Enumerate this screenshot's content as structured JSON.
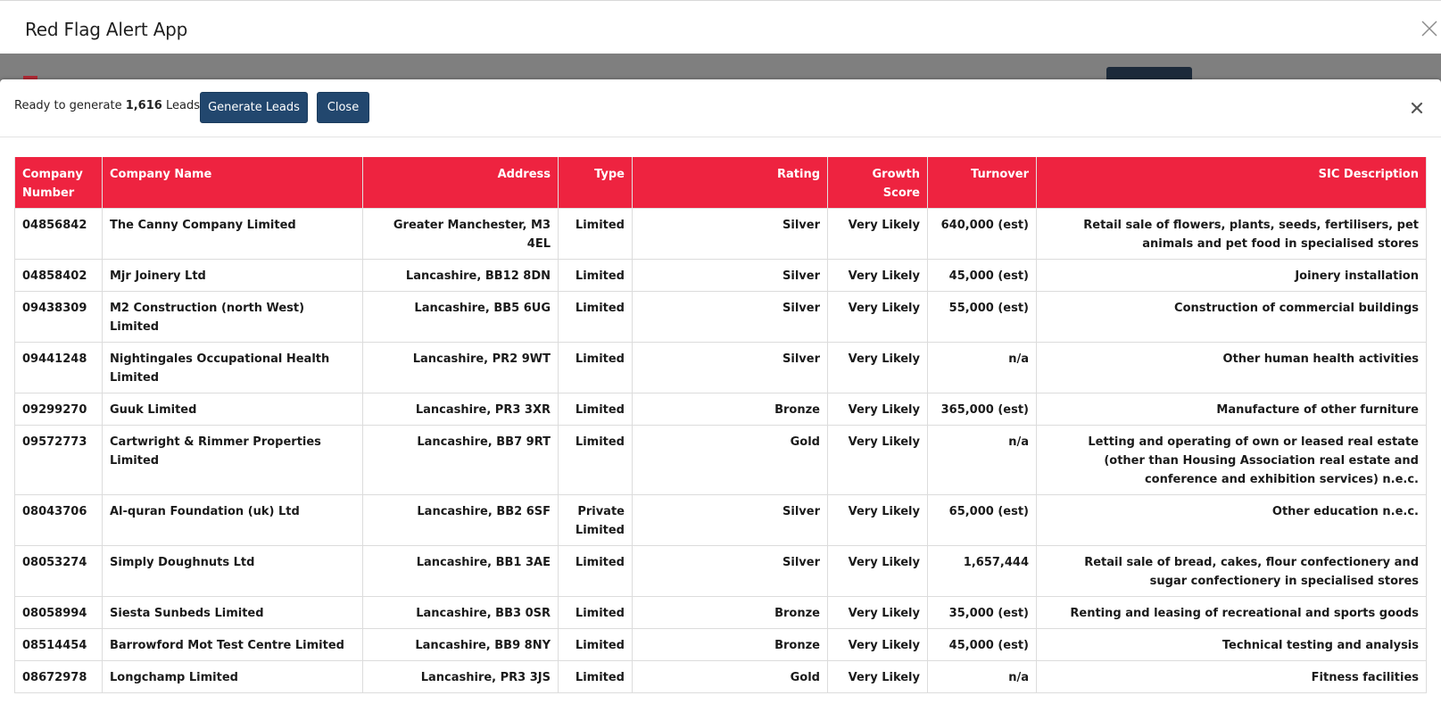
{
  "app": {
    "title": "Red Flag Alert App",
    "close_icon": "close-icon"
  },
  "dialog": {
    "ready_prefix": "Ready to generate ",
    "lead_count": "1,616",
    "ready_suffix": " Leads.",
    "generate_label": "Generate Leads",
    "close_label": "Close",
    "dismiss_icon": "close-x-icon"
  },
  "colors": {
    "header_red": "#ee2340",
    "button_navy": "#22476e",
    "backdrop_gray": "#7f7f7f"
  },
  "table": {
    "columns": [
      {
        "key": "number",
        "label": "Company Number"
      },
      {
        "key": "name",
        "label": "Company Name"
      },
      {
        "key": "address",
        "label": "Address"
      },
      {
        "key": "type",
        "label": "Type"
      },
      {
        "key": "rating",
        "label": "Rating"
      },
      {
        "key": "growth",
        "label": "Growth Score"
      },
      {
        "key": "turnover",
        "label": "Turnover"
      },
      {
        "key": "sic",
        "label": "SIC Description"
      }
    ],
    "rows": [
      {
        "number": "04856842",
        "name": "The Canny Company Limited",
        "address": "Greater Manchester, M3 4EL",
        "type": "Limited",
        "rating": "Silver",
        "growth": "Very Likely",
        "turnover": "640,000 (est)",
        "sic": "Retail sale of flowers, plants, seeds, fertilisers, pet animals and pet food in specialised stores"
      },
      {
        "number": "04858402",
        "name": "Mjr Joinery Ltd",
        "address": "Lancashire, BB12 8DN",
        "type": "Limited",
        "rating": "Silver",
        "growth": "Very Likely",
        "turnover": "45,000 (est)",
        "sic": "Joinery installation"
      },
      {
        "number": "09438309",
        "name": "M2 Construction (north West) Limited",
        "address": "Lancashire, BB5 6UG",
        "type": "Limited",
        "rating": "Silver",
        "growth": "Very Likely",
        "turnover": "55,000 (est)",
        "sic": "Construction of commercial buildings"
      },
      {
        "number": "09441248",
        "name": "Nightingales Occupational Health Limited",
        "address": "Lancashire, PR2 9WT",
        "type": "Limited",
        "rating": "Silver",
        "growth": "Very Likely",
        "turnover": "n/a",
        "sic": "Other human health activities"
      },
      {
        "number": "09299270",
        "name": "Guuk Limited",
        "address": "Lancashire, PR3 3XR",
        "type": "Limited",
        "rating": "Bronze",
        "growth": "Very Likely",
        "turnover": "365,000 (est)",
        "sic": "Manufacture of other furniture"
      },
      {
        "number": "09572773",
        "name": "Cartwright & Rimmer Properties Limited",
        "address": "Lancashire, BB7 9RT",
        "type": "Limited",
        "rating": "Gold",
        "growth": "Very Likely",
        "turnover": "n/a",
        "sic": "Letting and operating of own or leased real estate (other than Housing Association real estate and conference and exhibition services) n.e.c."
      },
      {
        "number": "08043706",
        "name": "Al-quran Foundation (uk) Ltd",
        "address": "Lancashire, BB2 6SF",
        "type": "Private Limited",
        "rating": "Silver",
        "growth": "Very Likely",
        "turnover": "65,000 (est)",
        "sic": "Other education n.e.c."
      },
      {
        "number": "08053274",
        "name": "Simply Doughnuts Ltd",
        "address": "Lancashire, BB1 3AE",
        "type": "Limited",
        "rating": "Silver",
        "growth": "Very Likely",
        "turnover": "1,657,444",
        "sic": "Retail sale of bread, cakes, flour confectionery and sugar confectionery in specialised stores"
      },
      {
        "number": "08058994",
        "name": "Siesta Sunbeds Limited",
        "address": "Lancashire, BB3 0SR",
        "type": "Limited",
        "rating": "Bronze",
        "growth": "Very Likely",
        "turnover": "35,000 (est)",
        "sic": "Renting and leasing of recreational and sports goods"
      },
      {
        "number": "08514454",
        "name": "Barrowford Mot Test Centre Limited",
        "address": "Lancashire, BB9 8NY",
        "type": "Limited",
        "rating": "Bronze",
        "growth": "Very Likely",
        "turnover": "45,000 (est)",
        "sic": "Technical testing and analysis"
      },
      {
        "number": "08672978",
        "name": "Longchamp Limited",
        "address": "Lancashire, PR3 3JS",
        "type": "Limited",
        "rating": "Gold",
        "growth": "Very Likely",
        "turnover": "n/a",
        "sic": "Fitness facilities"
      }
    ]
  }
}
